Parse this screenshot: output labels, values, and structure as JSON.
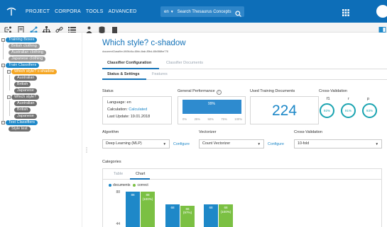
{
  "header": {
    "nav": [
      "PROJECT",
      "CORPORA",
      "TOOLS",
      "ADVANCED"
    ],
    "search_lang": "en",
    "search_placeholder": "Search Thesaurus Concepts"
  },
  "sidebar": {
    "items": [
      {
        "label": "Training Boxes"
      },
      {
        "label": "British clothing"
      },
      {
        "label": "Australian clothing"
      },
      {
        "label": "Japanese clothing"
      },
      {
        "label": "Train Classifiers"
      },
      {
        "label": "Which style? c-shadow"
      },
      {
        "label": "Australian"
      },
      {
        "label": "British"
      },
      {
        "label": "Japanese"
      },
      {
        "label": "Which style?"
      },
      {
        "label": "Australian"
      },
      {
        "label": "British"
      },
      {
        "label": "Japanese"
      },
      {
        "label": "Test Classifiers"
      },
      {
        "label": "Style test"
      }
    ]
  },
  "main": {
    "title": "Which style? c-shadow",
    "id_text": "documentClassifier-6f494d4a-48bb-4bab-89bd-48b086fbe778",
    "tabs": [
      "Classifier Configuration",
      "Classifier Documents"
    ],
    "subtabs": [
      "Status & Settings",
      "Features"
    ],
    "status": {
      "title": "Status",
      "language": "Language: en",
      "calc_prefix": "Calculation: ",
      "calc_value": "Calculated",
      "last_update": "Last Update: 19.01.2018"
    },
    "performance": {
      "title": "General Performance",
      "value_label": "99%",
      "value": 0.99,
      "ticks": [
        "0%",
        "25%",
        "50%",
        "75%",
        "100%"
      ]
    },
    "training_docs": {
      "title": "Used Training Documents",
      "count": "224"
    },
    "cross_validation_top": {
      "title": "Cross-Validation",
      "metrics": [
        {
          "letter": "f1",
          "value": "92%"
        },
        {
          "letter": "r",
          "value": "91%"
        },
        {
          "letter": "p",
          "value": "93%"
        }
      ]
    },
    "algorithm": {
      "label": "Algorithm",
      "value": "Deep Learning (MLP)",
      "configure": "Configure"
    },
    "vectorizer": {
      "label": "Vectorizer",
      "value": "Count Vectorizer",
      "configure": "Configure"
    },
    "cross_validation": {
      "label": "Cross-Validation",
      "value": "10-fold"
    },
    "categories": {
      "label": "Categories",
      "tabs": [
        "Table",
        "Chart"
      ]
    }
  },
  "chart_data": {
    "type": "bar",
    "legend": [
      "documents",
      "correct"
    ],
    "colors": {
      "documents": "#1e88c8",
      "correct": "#7bc043"
    },
    "yticks": [
      "88",
      "44"
    ],
    "series": [
      {
        "name": "documents",
        "values": [
          88,
          68,
          68
        ],
        "labels": [
          "88",
          "68",
          "68"
        ]
      },
      {
        "name": "correct",
        "values": [
          88,
          66,
          68
        ],
        "labels": [
          "88\n(100%)",
          "66\n(97%)",
          "68\n(100%)"
        ]
      }
    ],
    "ylim": [
      28,
      88
    ]
  }
}
